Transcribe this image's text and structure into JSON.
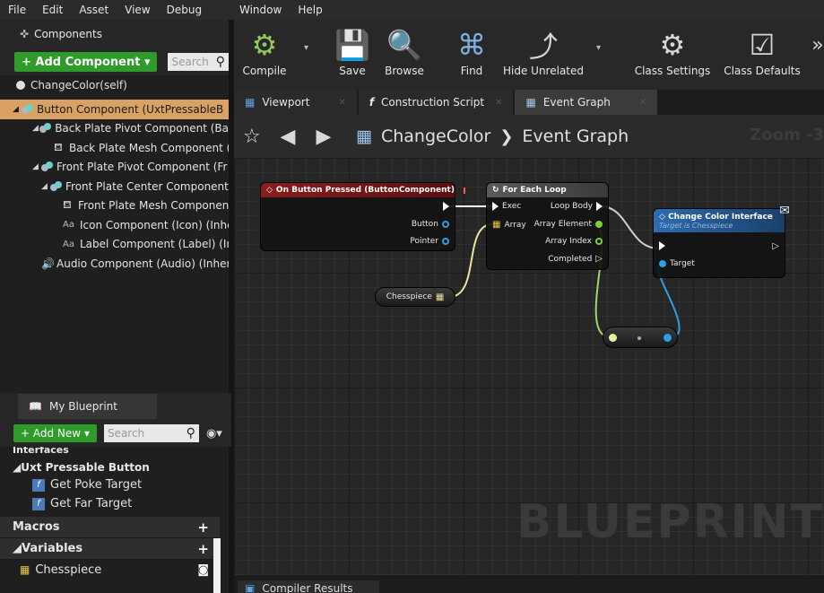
{
  "menu": {
    "left": [
      "File",
      "Edit",
      "Asset",
      "View",
      "Debug"
    ],
    "right": [
      "Window",
      "Help"
    ]
  },
  "components": {
    "tab_label": "Components",
    "add_label": "+ Add Component ▾",
    "search_placeholder": "Search",
    "self_label": "ChangeColor(self)",
    "tree": [
      {
        "label": "Button Component (UxtPressableB",
        "icon": "component",
        "arrow": "◢",
        "indent": 14,
        "selected": true
      },
      {
        "label": "Back Plate Pivot Component (Ba",
        "icon": "component",
        "arrow": "◢",
        "indent": 36,
        "selected": false
      },
      {
        "label": "Back Plate Mesh Component (I",
        "icon": "mesh",
        "arrow": "",
        "indent": 60,
        "selected": false
      },
      {
        "label": "Front Plate Pivot Component (Fr",
        "icon": "component",
        "arrow": "◢",
        "indent": 36,
        "selected": false
      },
      {
        "label": "Front Plate Center Component",
        "icon": "component",
        "arrow": "◢",
        "indent": 46,
        "selected": false
      },
      {
        "label": "Front Plate Mesh Component",
        "icon": "mesh",
        "arrow": "",
        "indent": 70,
        "selected": false
      },
      {
        "label": "Icon Component (Icon) (Inher",
        "icon": "text",
        "arrow": "",
        "indent": 70,
        "selected": false
      },
      {
        "label": "Label Component (Label) (Inl",
        "icon": "text",
        "arrow": "",
        "indent": 70,
        "selected": false
      },
      {
        "label": "Audio Component (Audio) (Inheri",
        "icon": "audio",
        "arrow": "",
        "indent": 46,
        "selected": false
      }
    ]
  },
  "my_blueprint": {
    "tab_label": "My Blueprint",
    "add_label": "+ Add New ▾",
    "search_placeholder": "Search",
    "interfaces_label": "Interfaces",
    "interface_group": "◢Uxt Pressable Button",
    "functions": [
      "Get Poke Target",
      "Get Far Target"
    ],
    "macros_label": "Macros",
    "variables_label": "◢Variables",
    "variables": [
      "Chesspiece"
    ]
  },
  "toolbar": {
    "compile": "Compile",
    "save": "Save",
    "browse": "Browse",
    "find": "Find",
    "hide_unrelated": "Hide Unrelated",
    "class_settings": "Class Settings",
    "class_defaults": "Class Defaults"
  },
  "graph_tabs": [
    "Viewport",
    "Construction Script",
    "Event Graph"
  ],
  "breadcrumb": {
    "blueprint": "ChangeColor",
    "graph": "Event Graph"
  },
  "zoom_label": "Zoom -3",
  "watermark": "BLUEPRINT",
  "nodes": {
    "event": {
      "title": "On Button Pressed (ButtonComponent)",
      "pins": [
        "Button",
        "Pointer"
      ]
    },
    "loop": {
      "title": "For Each Loop",
      "in_pins": [
        "Exec",
        "Array"
      ],
      "out_pins": [
        "Loop Body",
        "Array Element",
        "Array Index",
        "Completed"
      ]
    },
    "interface": {
      "title": "Change Color Interface",
      "subtitle": "Target is Chesspiece",
      "pins": [
        "Target"
      ]
    },
    "variable": {
      "label": "Chesspiece"
    }
  },
  "bottom_tab": "Compiler Results",
  "colors": {
    "selected": "#d9a163",
    "green_button": "#2f9b2a",
    "event_header": "#8a1d1d",
    "loop_header": "#5a5a5a",
    "interface_header": "#2d6cb0",
    "exec_wire": "#ffffff",
    "object_pin": "#2e9fe0",
    "array_pin": "#e8c948",
    "int_pin": "#7ad13a"
  }
}
